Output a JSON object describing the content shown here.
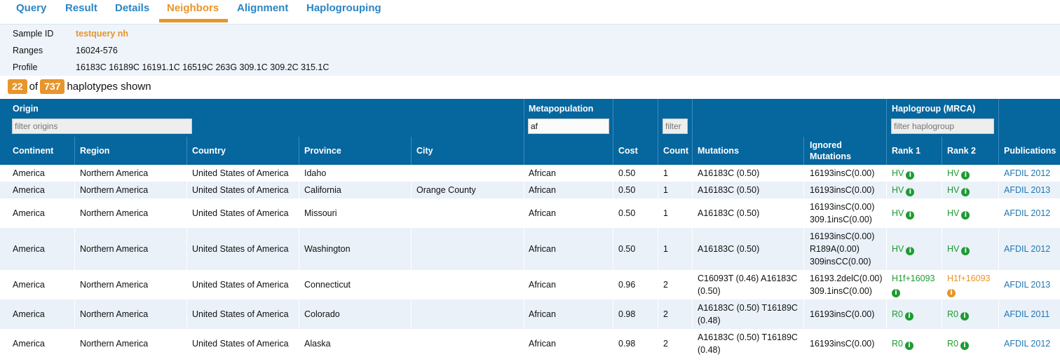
{
  "tabs": [
    {
      "label": "Query"
    },
    {
      "label": "Result"
    },
    {
      "label": "Details"
    },
    {
      "label": "Neighbors",
      "active": true
    },
    {
      "label": "Alignment"
    },
    {
      "label": "Haplogrouping"
    }
  ],
  "sample": {
    "id_label": "Sample ID",
    "id_value": "testquery nh",
    "ranges_label": "Ranges",
    "ranges_value": "16024-576",
    "profile_label": "Profile",
    "profile_value": "16183C 16189C 16191.1C 16519C 263G 309.1C 309.2C 315.1C"
  },
  "summary": {
    "shown": "22",
    "of_text": "of",
    "total": "737",
    "suffix": "haplotypes shown"
  },
  "table": {
    "group_headers": {
      "origin": "Origin",
      "metapopulation": "Metapopulation",
      "haplogroup": "Haplogroup (MRCA)"
    },
    "filters": {
      "origins_placeholder": "filter origins",
      "metapopulation_value": "af",
      "count_placeholder": "filter",
      "haplogroup_placeholder": "filter haplogroup"
    },
    "columns": {
      "continent": "Continent",
      "region": "Region",
      "country": "Country",
      "province": "Province",
      "city": "City",
      "cost": "Cost",
      "count": "Count",
      "mutations": "Mutations",
      "ignored_1": "Ignored",
      "ignored_2": "Mutations",
      "rank1": "Rank 1",
      "rank2": "Rank 2",
      "publications": "Publications"
    },
    "rows": [
      {
        "continent": "America",
        "region": "Northern America",
        "country": "United States of America",
        "province": "Idaho",
        "city": "",
        "metapop": "African",
        "cost": "0.50",
        "count": "1",
        "mutations": [
          "A16183C (0.50)"
        ],
        "ignored": [
          "16193insC(0.00)"
        ],
        "rank1": [
          "HV"
        ],
        "rank1_color": "green",
        "rank2": [
          "HV"
        ],
        "rank2_color": "green",
        "pub": "AFDIL 2012"
      },
      {
        "continent": "America",
        "region": "Northern America",
        "country": "United States of America",
        "province": "California",
        "city": "Orange County",
        "metapop": "African",
        "cost": "0.50",
        "count": "1",
        "mutations": [
          "A16183C (0.50)"
        ],
        "ignored": [
          "16193insC(0.00)"
        ],
        "rank1": [
          "HV"
        ],
        "rank1_color": "green",
        "rank2": [
          "HV"
        ],
        "rank2_color": "green",
        "pub": "AFDIL 2013"
      },
      {
        "continent": "America",
        "region": "Northern America",
        "country": "United States of America",
        "province": "Missouri",
        "city": "",
        "metapop": "African",
        "cost": "0.50",
        "count": "1",
        "mutations": [
          "A16183C (0.50)"
        ],
        "ignored": [
          "16193insC(0.00)",
          "309.1insC(0.00)"
        ],
        "rank1": [
          "HV"
        ],
        "rank1_color": "green",
        "rank2": [
          "HV"
        ],
        "rank2_color": "green",
        "pub": "AFDIL 2012"
      },
      {
        "continent": "America",
        "region": "Northern America",
        "country": "United States of America",
        "province": "Washington",
        "city": "",
        "metapop": "African",
        "cost": "0.50",
        "count": "1",
        "mutations": [
          "A16183C (0.50)"
        ],
        "ignored": [
          "16193insC(0.00)",
          "R189A(0.00)",
          "309insCC(0.00)"
        ],
        "rank1": [
          "HV"
        ],
        "rank1_color": "green",
        "rank2": [
          "HV"
        ],
        "rank2_color": "green",
        "pub": "AFDIL 2012"
      },
      {
        "continent": "America",
        "region": "Northern America",
        "country": "United States of America",
        "province": "Connecticut",
        "city": "",
        "metapop": "African",
        "cost": "0.96",
        "count": "2",
        "mutations": [
          "C16093T (0.46) A16183C",
          "(0.50)"
        ],
        "ignored": [
          "16193.2delC(0.00)",
          "309.1insC(0.00)"
        ],
        "rank1": [
          "H1f+16093"
        ],
        "rank1_color": "green",
        "rank2": [
          "H1f+16093"
        ],
        "rank2_color": "orange",
        "pub": "AFDIL 2013"
      },
      {
        "continent": "America",
        "region": "Northern America",
        "country": "United States of America",
        "province": "Colorado",
        "city": "",
        "metapop": "African",
        "cost": "0.98",
        "count": "2",
        "mutations": [
          "A16183C (0.50) T16189C",
          "(0.48)"
        ],
        "ignored": [
          "16193insC(0.00)"
        ],
        "rank1": [
          "R0"
        ],
        "rank1_color": "green",
        "rank2": [
          "R0"
        ],
        "rank2_color": "green",
        "pub": "AFDIL 2011"
      },
      {
        "continent": "America",
        "region": "Northern America",
        "country": "United States of America",
        "province": "Alaska",
        "city": "",
        "metapop": "African",
        "cost": "0.98",
        "count": "2",
        "mutations": [
          "A16183C (0.50) T16189C",
          "(0.48)"
        ],
        "ignored": [
          "16193insC(0.00)"
        ],
        "rank1": [
          "R0"
        ],
        "rank1_color": "green",
        "rank2": [
          "R0"
        ],
        "rank2_color": "green",
        "pub": "AFDIL 2012"
      }
    ]
  },
  "colors": {
    "accent_orange": "#e8952a",
    "link_blue": "#2a86c4",
    "header_blue": "#06669e",
    "haplogroup_green": "#1e9b33",
    "row_alt": "#eaf1f8"
  },
  "icons": [
    "info-circle-icon"
  ]
}
